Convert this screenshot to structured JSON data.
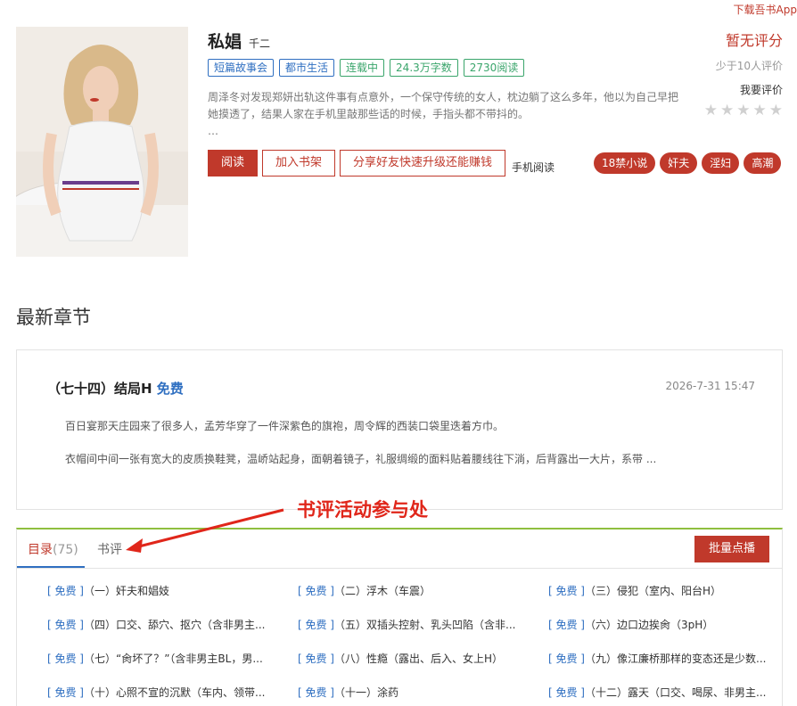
{
  "top_link": "下载吾书App",
  "book": {
    "title": "私娼",
    "author": "千二",
    "tags": [
      {
        "label": "短篇故事会",
        "color": "blue"
      },
      {
        "label": "都市生活",
        "color": "blue"
      },
      {
        "label": "连载中",
        "color": "green"
      },
      {
        "label": "24.3万字数",
        "color": "green"
      },
      {
        "label": "2730阅读",
        "color": "green"
      }
    ],
    "description": "周泽冬对发现郑妍出轨这件事有点意外，一个保守传统的女人，枕边躺了这么多年，他以为自己早把她摸透了，结果人家在手机里敲那些话的时候，手指头都不带抖的。",
    "ellipsis": "…"
  },
  "actions": {
    "read": "阅读",
    "add_shelf": "加入书架",
    "share": "分享好友快速升级还能赚钱",
    "mobile_read": "手机阅读"
  },
  "keyword_pills": [
    "18禁小说",
    "奸夫",
    "淫妇",
    "高潮"
  ],
  "rating": {
    "title": "暂无评分",
    "sub": "少于10人评价",
    "my_rating": "我要评价",
    "stars": 5
  },
  "latest": {
    "section_title": "最新章节",
    "chapter_title": "（七十四）结局H",
    "free_label": "免费",
    "time": "2026-7-31 15:47",
    "para1": "百日宴那天庄园来了很多人，孟芳华穿了一件深紫色的旗袍，周令辉的西装口袋里迭着方巾。",
    "para2": "衣帽间中间一张有宽大的皮质换鞋凳，温峤站起身，面朝着镜子，礼服绸缎的面料贴着腰线往下淌，后背露出一大片，系带 ..."
  },
  "annotation": "书评活动参与处",
  "toc": {
    "tab_toc": "目录",
    "tab_count": "(75)",
    "tab_review": "书评",
    "bulk_button": "批量点播",
    "free_tag": "[ 免费 ]",
    "items": [
      "（一）奸夫和娼妓",
      "（二）浮木（车震）",
      "（三）侵犯（室内、阳台H）",
      "（四）口交、舔穴、抠穴（含非男主...",
      "（五）双插头控射、乳头凹陷（含非...",
      "（六）边口边挨肏（3pH）",
      "（七）“肏坏了？”（含非男主BL，男...",
      "（八）性瘾（露出、后入、女上H）",
      "（九）像江廉桥那样的变态还是少数...",
      "（十）心照不宣的沉默（车内、领带...",
      "（十一）涂药",
      "（十二）露天（口交、喝尿、非男主..."
    ]
  },
  "colors": {
    "accent_red": "#c0392b",
    "link_blue": "#2f6fc1",
    "tag_green": "#3aa56b",
    "tab_border_green": "#8fbf3e"
  }
}
